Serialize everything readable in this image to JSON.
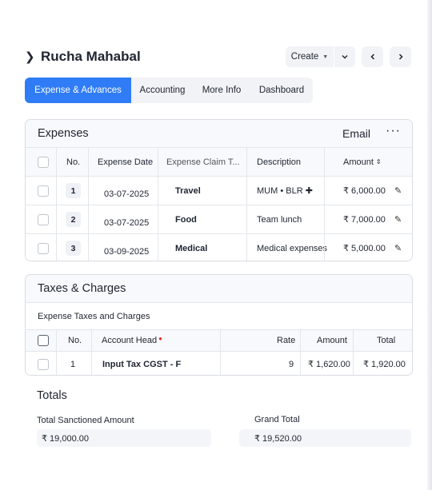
{
  "header": {
    "title": "Rucha Mahabal",
    "create_label": "Create",
    "prev_icon": "‹",
    "next_icon": "›"
  },
  "tabs": [
    {
      "label": "Expense & Advances"
    },
    {
      "label": "Accounting"
    },
    {
      "label": "More Info"
    },
    {
      "label": "Dashboard"
    }
  ],
  "expenses": {
    "title": "Expenses",
    "email_label": "Email",
    "more_label": "···",
    "columns": {
      "no": "No.",
      "date": "Expense Date",
      "claim": "Expense Claim T...",
      "desc": "Description",
      "amount": "Amount"
    },
    "rows": [
      {
        "no": "1",
        "date": "03-07-2025",
        "claim": "Travel",
        "desc": "MUM • BLR ✚",
        "amount": "₹ 6,000.00"
      },
      {
        "no": "2",
        "date": "03-07-2025",
        "claim": "Food",
        "desc": "Team lunch",
        "amount": "₹ 7,000.00"
      },
      {
        "no": "3",
        "date": "03-09-2025",
        "claim": "Medical",
        "desc": "Medical expenses",
        "amount": "₹ 5,000.00"
      }
    ]
  },
  "taxes": {
    "title": "Taxes & Charges",
    "subtitle": "Expense Taxes and Charges",
    "columns": {
      "no": "No.",
      "account": "Account Head",
      "rate": "Rate",
      "amount": "Amount",
      "total": "Total"
    },
    "rows": [
      {
        "no": "1",
        "account": "Input Tax CGST - F",
        "rate": "9",
        "amount": "₹ 1,620.00",
        "total": "₹ 1,920.00"
      }
    ]
  },
  "totals": {
    "title": "Totals",
    "sanctioned_label": "Total Sanctioned Amount",
    "sanctioned_value": "₹ 19,000.00",
    "grand_label": "Grand Total",
    "grand_value": "₹ 19,520.00"
  }
}
